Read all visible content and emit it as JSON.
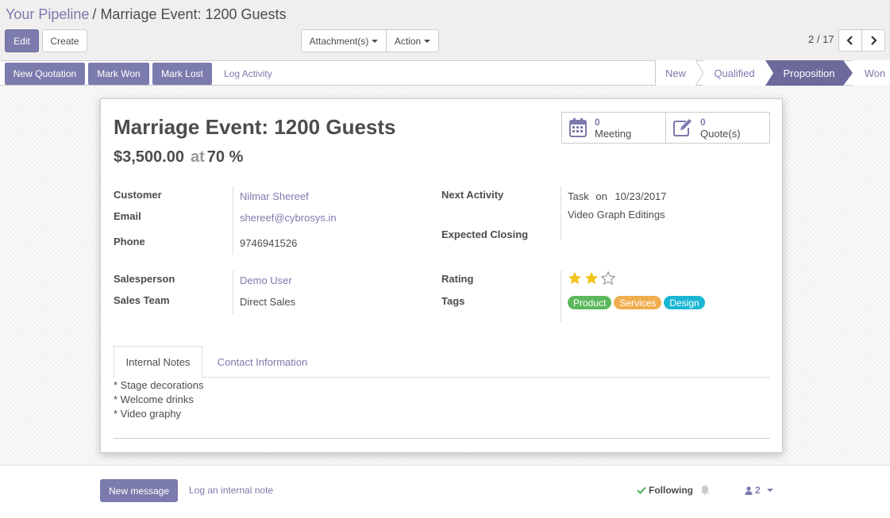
{
  "breadcrumb": {
    "parent": "Your Pipeline",
    "separator": "/",
    "current": "Marriage Event: 1200 Guests"
  },
  "toolbar": {
    "edit": "Edit",
    "create": "Create",
    "attachments": "Attachment(s)",
    "action": "Action"
  },
  "pager": {
    "value": "2 / 17"
  },
  "statusbar": {
    "buttons": [
      "New Quotation",
      "Mark Won",
      "Mark Lost"
    ],
    "log_activity": "Log Activity",
    "stages": [
      "New",
      "Qualified",
      "Proposition",
      "Won"
    ],
    "active_stage": "Proposition"
  },
  "sheet": {
    "title": "Marriage Event: 1200 Guests",
    "revenue": "$3,500.00",
    "at": "at",
    "probability": "70 %",
    "smart_buttons": [
      {
        "count": "0",
        "label": "Meeting",
        "icon": "calendar-icon"
      },
      {
        "count": "0",
        "label": "Quote(s)",
        "icon": "edit-icon"
      }
    ],
    "fields": {
      "customer_label": "Customer",
      "customer": "Nilmar Shereef",
      "email_label": "Email",
      "email": "shereef@cybrosys.in",
      "phone_label": "Phone",
      "phone": "9746941526",
      "salesperson_label": "Salesperson",
      "salesperson": "Demo User",
      "sales_team_label": "Sales Team",
      "sales_team": "Direct Sales",
      "next_activity_label": "Next Activity",
      "next_activity": "Task",
      "on": "on",
      "next_activity_date": "10/23/2017",
      "next_activity_summary": "Video Graph Editings",
      "expected_closing_label": "Expected Closing",
      "rating_label": "Rating",
      "rating": 2,
      "rating_max": 3,
      "tags_label": "Tags"
    },
    "tags": [
      {
        "name": "Product",
        "color": "#5cb85c"
      },
      {
        "name": "Services",
        "color": "#f0ad4e"
      },
      {
        "name": "Design",
        "color": "#1ab7d4"
      }
    ],
    "tabs": [
      "Internal Notes",
      "Contact Information"
    ],
    "notes": [
      "* Stage decorations",
      "* Welcome drinks",
      "* Video graphy"
    ]
  },
  "chatter": {
    "new_message": "New message",
    "log_note": "Log an internal note",
    "following": "Following",
    "followers_count": "2"
  },
  "colors": {
    "brand": "#7c7bad",
    "active_stage": "#6b6a9b",
    "star": "#f0c419"
  }
}
